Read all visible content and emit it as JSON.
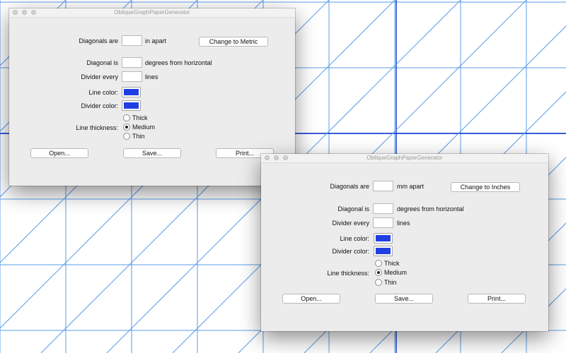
{
  "background": {
    "grid_color": "#5a9ce8",
    "divider_color": "#1a44d6"
  },
  "windows": [
    {
      "title": "ObliqueGraphPaperGenerator",
      "diagonals_label": "Diagonals are",
      "diagonals_value": "",
      "diagonals_unit": "in apart",
      "change_button": "Change to Metric",
      "diagonal_label": "Diagonal is",
      "diagonal_value": "",
      "diagonal_unit": "degrees from horizontal",
      "divider_label": "Divider every",
      "divider_value": "",
      "divider_unit": "lines",
      "line_color_label": "Line color:",
      "line_color": "#1f3fe3",
      "divider_color_label": "Divider color:",
      "divider_color": "#1f3fe3",
      "thickness_label": "Line thickness:",
      "thickness_options": [
        "Thick",
        "Medium",
        "Thin"
      ],
      "thickness_selected": "Medium",
      "open_button": "Open...",
      "save_button": "Save...",
      "print_button": "Print..."
    },
    {
      "title": "ObliqueGraphPaperGenerator",
      "diagonals_label": "Diagonals are",
      "diagonals_value": "",
      "diagonals_unit": "mm apart",
      "change_button": "Change to Inches",
      "diagonal_label": "Diagonal is",
      "diagonal_value": "",
      "diagonal_unit": "degrees from horizontal",
      "divider_label": "Divider every",
      "divider_value": "",
      "divider_unit": "lines",
      "line_color_label": "Line color:",
      "line_color": "#1f3fe3",
      "divider_color_label": "Divider color:",
      "divider_color": "#1f3fe3",
      "thickness_label": "Line thickness:",
      "thickness_options": [
        "Thick",
        "Medium",
        "Thin"
      ],
      "thickness_selected": "Medium",
      "open_button": "Open...",
      "save_button": "Save...",
      "print_button": "Print..."
    }
  ]
}
